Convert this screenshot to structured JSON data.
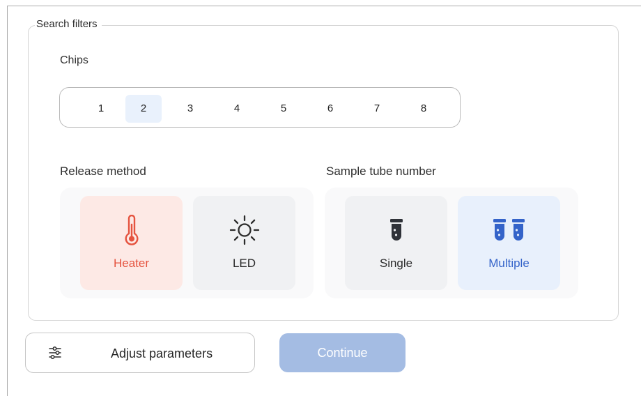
{
  "filters": {
    "legend": "Search filters",
    "chips": {
      "label": "Chips",
      "items": [
        "1",
        "2",
        "3",
        "4",
        "5",
        "6",
        "7",
        "8"
      ],
      "selected": "2"
    },
    "release_method": {
      "label": "Release method",
      "options": [
        {
          "label": "Heater",
          "icon": "thermometer-icon",
          "selected": true,
          "color": "#e5533f"
        },
        {
          "label": "LED",
          "icon": "sun-icon",
          "selected": false
        }
      ]
    },
    "sample_tube": {
      "label": "Sample tube number",
      "options": [
        {
          "label": "Single",
          "icon": "single-tube-icon",
          "selected": false
        },
        {
          "label": "Multiple",
          "icon": "multiple-tubes-icon",
          "selected": true,
          "color": "#3463c9"
        }
      ]
    }
  },
  "actions": {
    "adjust_label": "Adjust parameters",
    "adjust_icon": "sliders-icon",
    "continue_label": "Continue",
    "continue_enabled": false
  },
  "colors": {
    "accent_blue": "#3463c9",
    "accent_red": "#e5533f",
    "continue_disabled": "#a4bce3"
  }
}
